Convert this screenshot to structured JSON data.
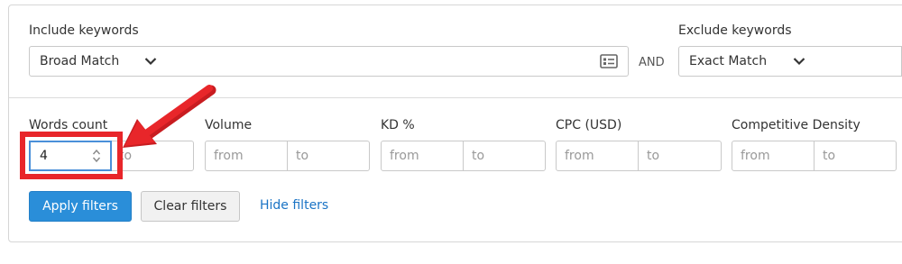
{
  "include": {
    "label": "Include keywords",
    "match_type": "Broad Match",
    "value": "",
    "list_icon": "list-card-icon"
  },
  "joiner": "AND",
  "exclude": {
    "label": "Exclude keywords",
    "match_type": "Exact Match",
    "value": ""
  },
  "filters": {
    "words_count": {
      "label": "Words count",
      "from_value": "4",
      "to_placeholder": "to"
    },
    "volume": {
      "label": "Volume",
      "from_placeholder": "from",
      "to_placeholder": "to"
    },
    "kd": {
      "label": "KD %",
      "from_placeholder": "from",
      "to_placeholder": "to"
    },
    "cpc": {
      "label": "CPC (USD)",
      "from_placeholder": "from",
      "to_placeholder": "to"
    },
    "competitive_density": {
      "label": "Competitive Density",
      "from_placeholder": "from",
      "to_placeholder": "to"
    }
  },
  "actions": {
    "apply": "Apply filters",
    "clear": "Clear filters",
    "hide": "Hide filters"
  },
  "colors": {
    "primary": "#2a8ed9",
    "link": "#1b74c5",
    "highlight": "#e8262a",
    "focus": "#4a90d9"
  },
  "annotation": {
    "arrow_icon": "red-arrow-icon"
  }
}
